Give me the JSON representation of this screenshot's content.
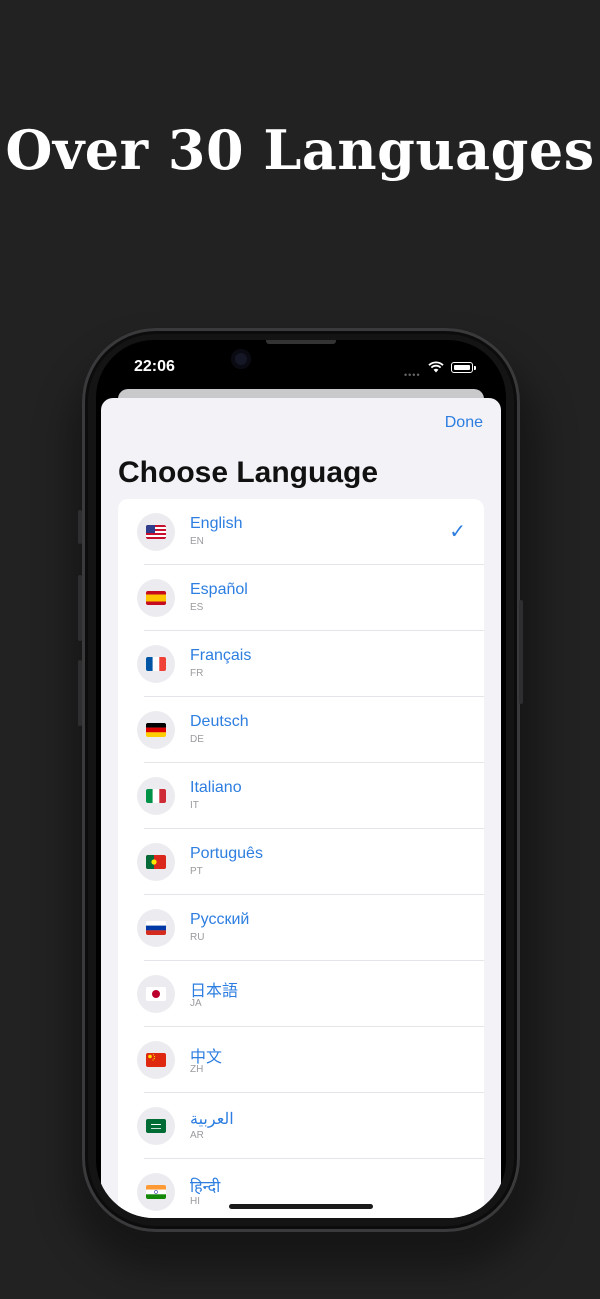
{
  "headline": "Over 30 Languages",
  "status": {
    "time": "22:06"
  },
  "sheet": {
    "done_label": "Done",
    "title": "Choose Language",
    "selected_index": 0,
    "languages": [
      {
        "name": "English",
        "code": "EN",
        "flag": "us-flag-icon"
      },
      {
        "name": "Español",
        "code": "ES",
        "flag": "spain-flag-icon"
      },
      {
        "name": "Français",
        "code": "FR",
        "flag": "france-flag-icon"
      },
      {
        "name": "Deutsch",
        "code": "DE",
        "flag": "germany-flag-icon"
      },
      {
        "name": "Italiano",
        "code": "IT",
        "flag": "italy-flag-icon"
      },
      {
        "name": "Português",
        "code": "PT",
        "flag": "portugal-flag-icon"
      },
      {
        "name": "Русский",
        "code": "RU",
        "flag": "russia-flag-icon"
      },
      {
        "name": "日本語",
        "code": "JA",
        "flag": "japan-flag-icon"
      },
      {
        "name": "中文",
        "code": "ZH",
        "flag": "china-flag-icon"
      },
      {
        "name": "العربية",
        "code": "AR",
        "flag": "saudi-flag-icon"
      },
      {
        "name": "हिन्दी",
        "code": "HI",
        "flag": "india-flag-icon"
      }
    ],
    "check_icon": "checkmark-icon"
  },
  "colors": {
    "accent": "#2d7ee0",
    "background": "#222222",
    "sheet": "#f2f2f7"
  }
}
